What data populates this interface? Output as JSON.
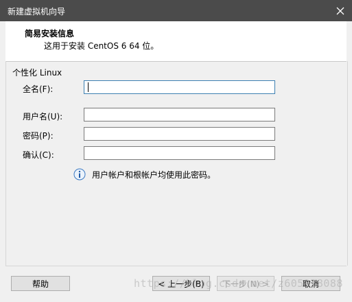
{
  "window": {
    "title": "新建虚拟机向导"
  },
  "header": {
    "title": "简易安装信息",
    "subtitle": "这用于安装 CentOS 6 64 位。"
  },
  "form": {
    "group_label": "个性化 Linux",
    "full_name": {
      "label": "全名(F):",
      "value": ""
    },
    "username": {
      "label": "用户名(U):",
      "value": ""
    },
    "password": {
      "label": "密码(P):",
      "value": ""
    },
    "confirm": {
      "label": "确认(C):",
      "value": ""
    }
  },
  "info": {
    "icon": "info-icon",
    "text": "用户帐户和根帐户均使用此密码。"
  },
  "buttons": {
    "help": "帮助",
    "back": "< 上一步(B)",
    "next": "下一步(N) >",
    "cancel": "取消"
  },
  "watermark": "https://blog.csdn.net/z605938088"
}
